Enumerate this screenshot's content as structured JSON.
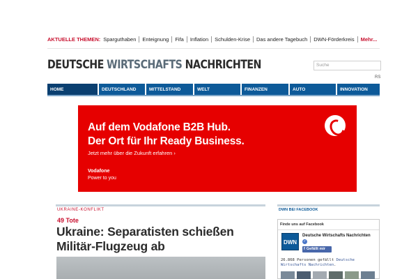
{
  "themes": {
    "label": "AKTUELLE THEMEN:",
    "items": [
      "Sparguthaben",
      "Enteignung",
      "Fifa",
      "Inflation",
      "Schulden-Krise",
      "Das andere Tagebuch",
      "DWN-Förderkreis"
    ],
    "more": "Mehr..."
  },
  "logo": {
    "word1": "DEUTSCHE",
    "word2": "WIRTSCHAFTS",
    "word3": "NACHRICHTEN"
  },
  "search": {
    "placeholder": "Suche"
  },
  "rss": "RS",
  "nav": {
    "tabs": [
      "HOME",
      "DEUTSCHLAND",
      "MITTELSTAND",
      "WELT",
      "FINANZEN",
      "AUTO",
      "INNOVATION"
    ],
    "active": "HOME"
  },
  "ad": {
    "headline_line1": "Auf dem Vodafone B2B Hub.",
    "headline_line2": "Der Ort für Ihr Ready Business.",
    "cta": "Jetzt mehr über die Zukunft erfahren  ›",
    "brand": "Vodafone",
    "tagline": "Power to you"
  },
  "article": {
    "category": "UKRAINE-KONFLIKT",
    "kicker": "49 Tote",
    "title": "Ukraine: Separatisten schießen Militär-Flugzeug ab"
  },
  "sidebar": {
    "heading": "DWN BEI FACEBOOK",
    "find_us": "Finde uns auf Facebook",
    "page_logo": "DWN",
    "page_name": "Deutsche Wirtschafts Nachrichten",
    "verified_mark": "✓",
    "like_icon": "f",
    "like_button": "Gefällt mir",
    "count_text": "26.868 Personen gefällt ",
    "count_link": "Deutsche Wirtschafts Nachrichten",
    "count_end": "."
  },
  "colors": {
    "brand_blue": "#0d5a99",
    "nav_active": "#0a3f70",
    "accent_red": "#c8102e",
    "vodafone_red": "#e60000",
    "facebook_blue": "#4867aa"
  }
}
